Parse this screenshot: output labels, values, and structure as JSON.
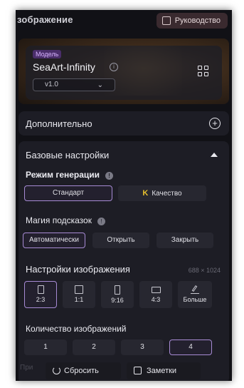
{
  "header": {
    "title": "зображение",
    "guide_label": "Руководство"
  },
  "model": {
    "badge": "Модель",
    "name": "SeaArt-Infinity",
    "version": "v1.0"
  },
  "advanced": {
    "label": "Дополнительно"
  },
  "base_settings": {
    "title": "Базовые настройки",
    "generation_mode": {
      "label": "Режим генерации",
      "options": [
        "Стандарт",
        "Качество"
      ],
      "selected": "Стандарт"
    },
    "prompt_magic": {
      "label": "Магия подсказок",
      "options": [
        "Автоматически",
        "Открыть",
        "Закрыть"
      ],
      "selected": "Автоматически"
    },
    "image_settings": {
      "label": "Настройки изображения",
      "dimensions": "688 × 1024",
      "ratios": [
        "2:3",
        "1:1",
        "9:16",
        "4:3",
        "Больше"
      ],
      "selected": "2:3"
    },
    "image_count": {
      "label": "Количество изображений",
      "options": [
        "1",
        "2",
        "3",
        "4"
      ],
      "selected": "4"
    }
  },
  "footer": {
    "hint": "При",
    "reset_label": "Сбросить",
    "notes_label": "Заметки"
  },
  "colors": {
    "panel_bg": "#1d1d25",
    "accent": "#a78bd4",
    "badge": "#d8b4ff",
    "quality_icon": "#e6c02e"
  }
}
